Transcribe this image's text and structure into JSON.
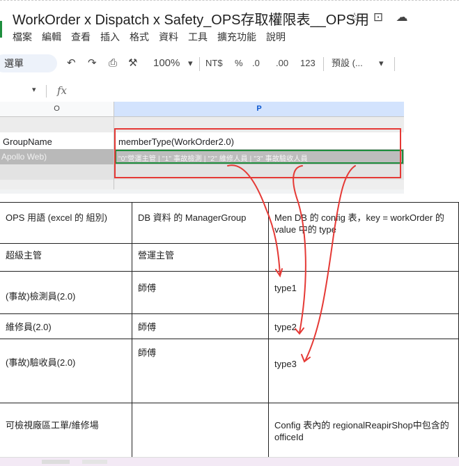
{
  "title": "WorkOrder x Dispatch x Safety_OPS存取權限表__OPS用",
  "title_icons": [
    "star-icon",
    "folder-move-icon",
    "cloud-status-icon"
  ],
  "menu": [
    "檔案",
    "編輯",
    "查看",
    "插入",
    "格式",
    "資料",
    "工具",
    "擴充功能",
    "說明"
  ],
  "toolbar": {
    "menus_label": "選單",
    "zoom": "100%",
    "currency": "NT$",
    "percent": "%",
    "dec_decrease": ".0",
    "dec_increase": ".00",
    "number_format": "123",
    "font_format": "預設 (..."
  },
  "formula_bar": {
    "fx": "fx"
  },
  "grid": {
    "col_o": "O",
    "col_p": "P",
    "cell_o_header": "GroupName",
    "cell_o_value": "Apollo Web)",
    "cell_p_header": "memberType(WorkOrder2.0)",
    "cell_p_value": "\"0\"營運主管  |  \"1\" 事故檢測  |  \"2\" 維修人員  |  \"3\" 事故驗收人員"
  },
  "table": {
    "headers": [
      "OPS 用語 (excel 的 組別)",
      "DB 資料 的 ManagerGroup",
      "Men DB 的 config 表，key = workOrder 的 value 中的 type"
    ],
    "rows": [
      [
        "超級主管",
        "營運主管",
        ""
      ],
      [
        "(事故)檢測員(2.0)",
        "師傅",
        "type1"
      ],
      [
        "維修員(2.0)",
        "師傅",
        "type2"
      ],
      [
        "(事故)驗收員(2.0)",
        "師傅",
        "type3"
      ],
      [
        "可檢視廠區工單/維修場",
        "",
        "Config 表內的 regionalReapirShop中包含的 officeId"
      ]
    ]
  },
  "annotation_color": "#e53935",
  "selection_color": "#1e8e3e"
}
